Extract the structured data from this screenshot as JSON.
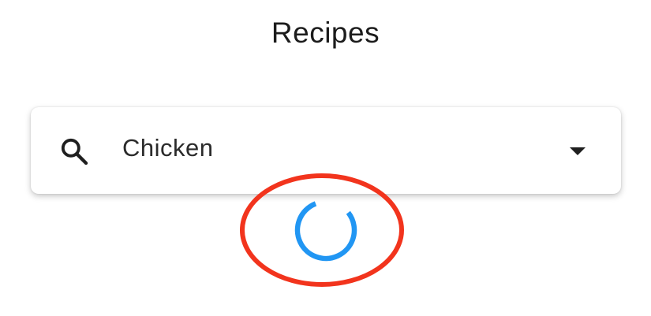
{
  "app_bar": {
    "title": "Recipes"
  },
  "search": {
    "value": "Chicken",
    "icon": "search-icon",
    "dropdown_icon": "arrow-drop-down-icon"
  },
  "loading": {
    "indicator": "circular-progress",
    "color": "#2196F3"
  },
  "annotation": {
    "shape": "ellipse",
    "color": "#F2341D"
  }
}
